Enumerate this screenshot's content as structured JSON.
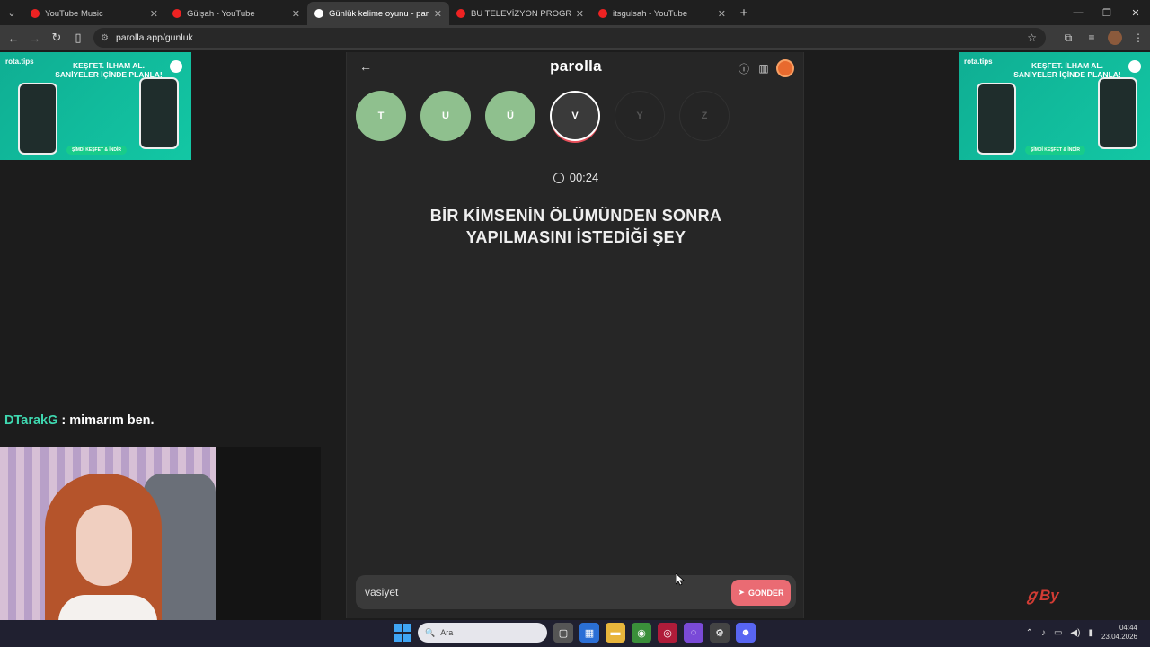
{
  "browser": {
    "tabs": [
      {
        "title": "YouTube Music",
        "active": false
      },
      {
        "title": "Gülşah - YouTube",
        "active": false
      },
      {
        "title": "Günlük kelime oyunu - parolla",
        "active": true
      },
      {
        "title": "BU TELEVİZYON PROGRAM NA",
        "active": false
      },
      {
        "title": "itsgulsah - YouTube",
        "active": false
      }
    ],
    "url": "parolla.app/gunluk"
  },
  "ads": {
    "brand": "rota.tips",
    "headline": "KEŞFET. İLHAM AL. SANİYELER İÇİNDE PLANLA!",
    "cta": "ŞİMDİ KEŞFET & İNDİR"
  },
  "app": {
    "logo": "parolla",
    "letters": [
      {
        "char": "T",
        "state": "done"
      },
      {
        "char": "U",
        "state": "done"
      },
      {
        "char": "Ü",
        "state": "done"
      },
      {
        "char": "V",
        "state": "current"
      },
      {
        "char": "Y",
        "state": "pending"
      },
      {
        "char": "Z",
        "state": "pending"
      }
    ],
    "timer": "00:24",
    "question_line1": "BİR KİMSENİN ÖLÜMÜNDEN SONRA",
    "question_line2": "YAPILMASINI İSTEDİĞİ ŞEY",
    "answer_value": "vasiyet",
    "send_label": "GÖNDER"
  },
  "overlay": {
    "chat_user": "DTarakG",
    "chat_message": ": mimarım ben."
  },
  "taskbar": {
    "search_label": "Ara",
    "time": "04:44",
    "date": "23.04.2026"
  },
  "colors": {
    "done": "#8fc08e",
    "current_ring": "#e8505b",
    "send": "#ea6b73",
    "chat_user": "#3fd8b0"
  }
}
